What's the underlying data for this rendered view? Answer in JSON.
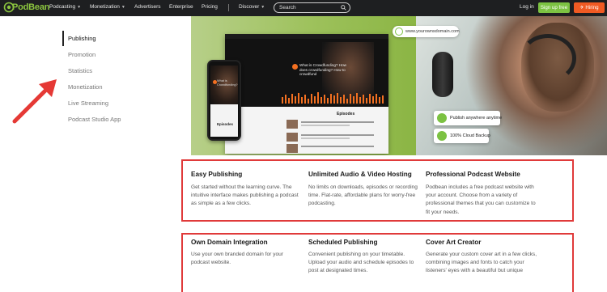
{
  "brand": {
    "name": "PodBean",
    "accent": "#7cc242",
    "hiring_color": "#f05a23",
    "highlight": "#e03a3a"
  },
  "nav": {
    "items": [
      {
        "label": "Podcasting",
        "dropdown": true
      },
      {
        "label": "Monetization",
        "dropdown": true
      },
      {
        "label": "Advertisers",
        "dropdown": false
      },
      {
        "label": "Enterprise",
        "dropdown": false
      },
      {
        "label": "Pricing",
        "dropdown": false
      },
      {
        "label": "Discover",
        "dropdown": true
      }
    ],
    "search_placeholder": "Search",
    "login": "Log in",
    "signup": "Sign up free",
    "hiring": "Hiring"
  },
  "sidebar": {
    "items": [
      {
        "label": "Publishing",
        "active": true
      },
      {
        "label": "Promotion",
        "active": false
      },
      {
        "label": "Statistics",
        "active": false
      },
      {
        "label": "Monetization",
        "active": false
      },
      {
        "label": "Live Streaming",
        "active": false
      },
      {
        "label": "Podcast Studio App",
        "active": false
      }
    ]
  },
  "hero": {
    "url_pill": "www.yourownsdomain.com",
    "badge_publish": "Publish anywhere anytime",
    "badge_cloud": "100% Cloud Backup",
    "episode_title": "What is Crowdfunding? How does crowdfunding? How to crowdfund",
    "episodes_heading": "Episodes",
    "phone_episodes_heading": "Episodes",
    "phone_title": "What is Crowdfunding?"
  },
  "features": [
    {
      "title": "Easy Publishing",
      "desc": "Get started without the learning curve. The intuitive interface makes publishing a podcast as simple as a few clicks."
    },
    {
      "title": "Unlimited Audio & Video Hosting",
      "desc": "No limits on downloads, episodes or recording time. Flat-rate, affordable plans for worry-free podcasting."
    },
    {
      "title": "Professional Podcast Website",
      "desc": "Podbean includes a free podcast website with your account. Choose from a variety of professional themes that you can customize to fit your needs."
    },
    {
      "title": "Own Domain Integration",
      "desc": "Use your own branded domain for your podcast website."
    },
    {
      "title": "Scheduled Publishing",
      "desc": "Convenient publishing on your timetable. Upload your audio and schedule episodes to post at designated times."
    },
    {
      "title": "Cover Art Creator",
      "desc": "Generate your custom cover art in a few clicks, combining images and fonts to catch your listeners' eyes with a beautiful but unique"
    }
  ]
}
